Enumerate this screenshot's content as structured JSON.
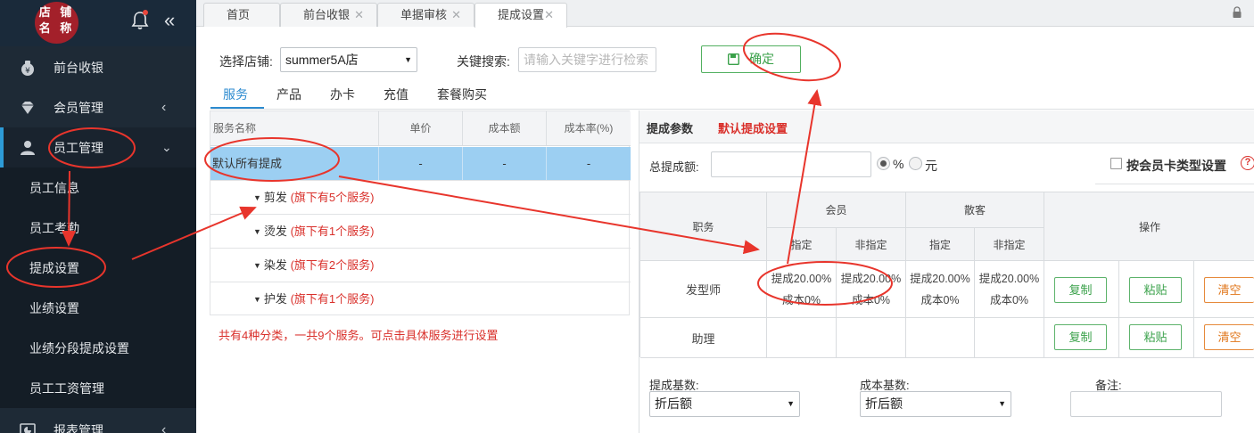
{
  "sidebar": {
    "logo_text": "店铺名称",
    "logo_line1": "店 铺",
    "logo_line2": "名 称",
    "menu": [
      {
        "label": "前台收银",
        "icon": "yen-bag-icon"
      },
      {
        "label": "会员管理",
        "icon": "diamond-icon"
      },
      {
        "label": "员工管理",
        "icon": "user-icon"
      }
    ],
    "submenu": [
      "员工信息",
      "员工考勤",
      "提成设置",
      "业绩设置",
      "业绩分段提成设置",
      "员工工资管理"
    ],
    "bottom_item": "报表管理"
  },
  "tabs": [
    {
      "label": "首页"
    },
    {
      "label": "前台收银"
    },
    {
      "label": "单据审核"
    },
    {
      "label": "提成设置"
    }
  ],
  "form": {
    "store_label": "选择店铺:",
    "store_value": "summer5A店",
    "keyword_label": "关键搜索:",
    "keyword_placeholder": "请输入关键字进行检索",
    "confirm_label": "确定"
  },
  "subtabs": [
    "服务",
    "产品",
    "办卡",
    "充值",
    "套餐购买"
  ],
  "left_table": {
    "headers": [
      "服务名称",
      "单价",
      "成本额",
      "成本率(%)"
    ],
    "default_row": {
      "name": "默认所有提成",
      "price": "-",
      "cost": "-",
      "rate": "-"
    },
    "categories": [
      {
        "name": "剪发",
        "count": "(旗下有5个服务)"
      },
      {
        "name": "烫发",
        "count": "(旗下有1个服务)"
      },
      {
        "name": "染发",
        "count": "(旗下有2个服务)"
      },
      {
        "name": "护发",
        "count": "(旗下有1个服务)"
      }
    ],
    "summary": "共有4种分类，一共9个服务。可点击具体服务进行设置"
  },
  "right_panel": {
    "param_label": "提成参数",
    "default_label": "默认提成设置",
    "total_label": "总提成额:",
    "percent_label": "%",
    "yuan_label": "元",
    "card_type_label": "按会员卡类型设置",
    "help": "?",
    "table": {
      "col_position": "职务",
      "col_member": "会员",
      "col_walkin": "散客",
      "col_action": "操作",
      "col_assigned": "指定",
      "col_unassigned": "非指定",
      "rows": [
        {
          "position": "发型师",
          "cells": [
            "提成20.00%",
            "提成20.00%",
            "提成20.00%",
            "提成20.00%"
          ],
          "costs": [
            "成本0%",
            "成本0%",
            "成本0%",
            "成本0%"
          ]
        },
        {
          "position": "助理",
          "cells": [
            "",
            "",
            "",
            ""
          ],
          "costs": [
            "",
            "",
            "",
            ""
          ]
        }
      ],
      "btn_copy": "复制",
      "btn_paste": "粘贴",
      "btn_clear": "清空"
    },
    "base_label": "提成基数:",
    "base_value": "折后额",
    "cost_base_label": "成本基数:",
    "cost_base_value": "折后额",
    "remark_label": "备注:"
  },
  "colors": {
    "sidebar_bg": "#1e2a36",
    "accent_blue": "#2d8bd0",
    "highlight_row": "#9ccff2",
    "annotation_red": "#e8352c",
    "green": "#3aa14a",
    "orange": "#e0761b"
  }
}
